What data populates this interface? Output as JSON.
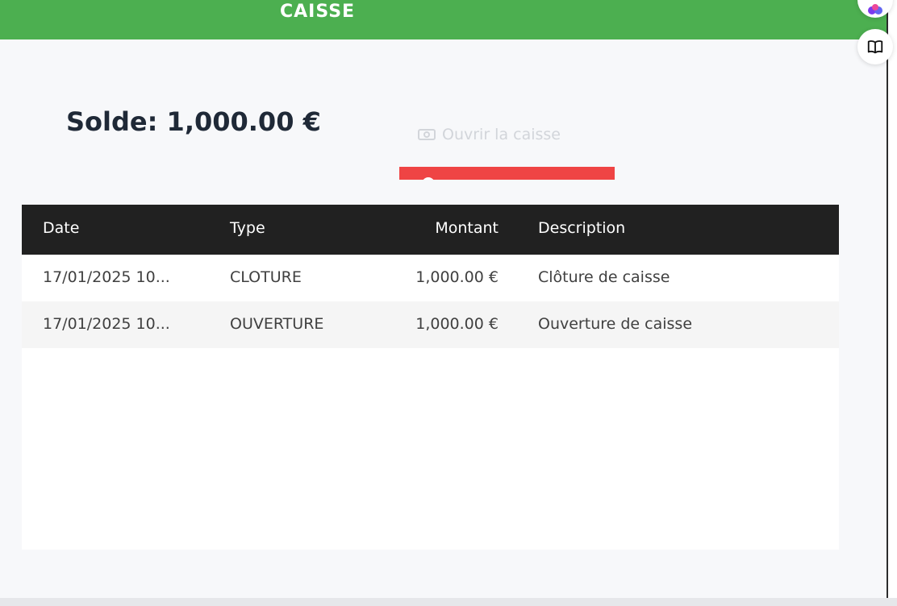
{
  "header": {
    "title": "CAISSE",
    "color": "#4caf50"
  },
  "balance": {
    "text": "Solde: 1,000.00 €"
  },
  "actions": {
    "open_label": "Ouvrir la caisse",
    "open_icon": "cash-icon",
    "red_button_color": "#ef4444"
  },
  "side_buttons": {
    "top_icon": "app-logo-icon",
    "book_icon": "book-icon"
  },
  "table": {
    "columns": [
      "Date",
      "Type",
      "Montant",
      "Description"
    ],
    "rows": [
      {
        "date": "17/01/2025 10...",
        "type": "CLOTURE",
        "amount": "1,000.00 €",
        "description": "Clôture de caisse"
      },
      {
        "date": "17/01/2025 10...",
        "type": "OUVERTURE",
        "amount": "1,000.00 €",
        "description": "Ouverture de caisse"
      }
    ]
  }
}
